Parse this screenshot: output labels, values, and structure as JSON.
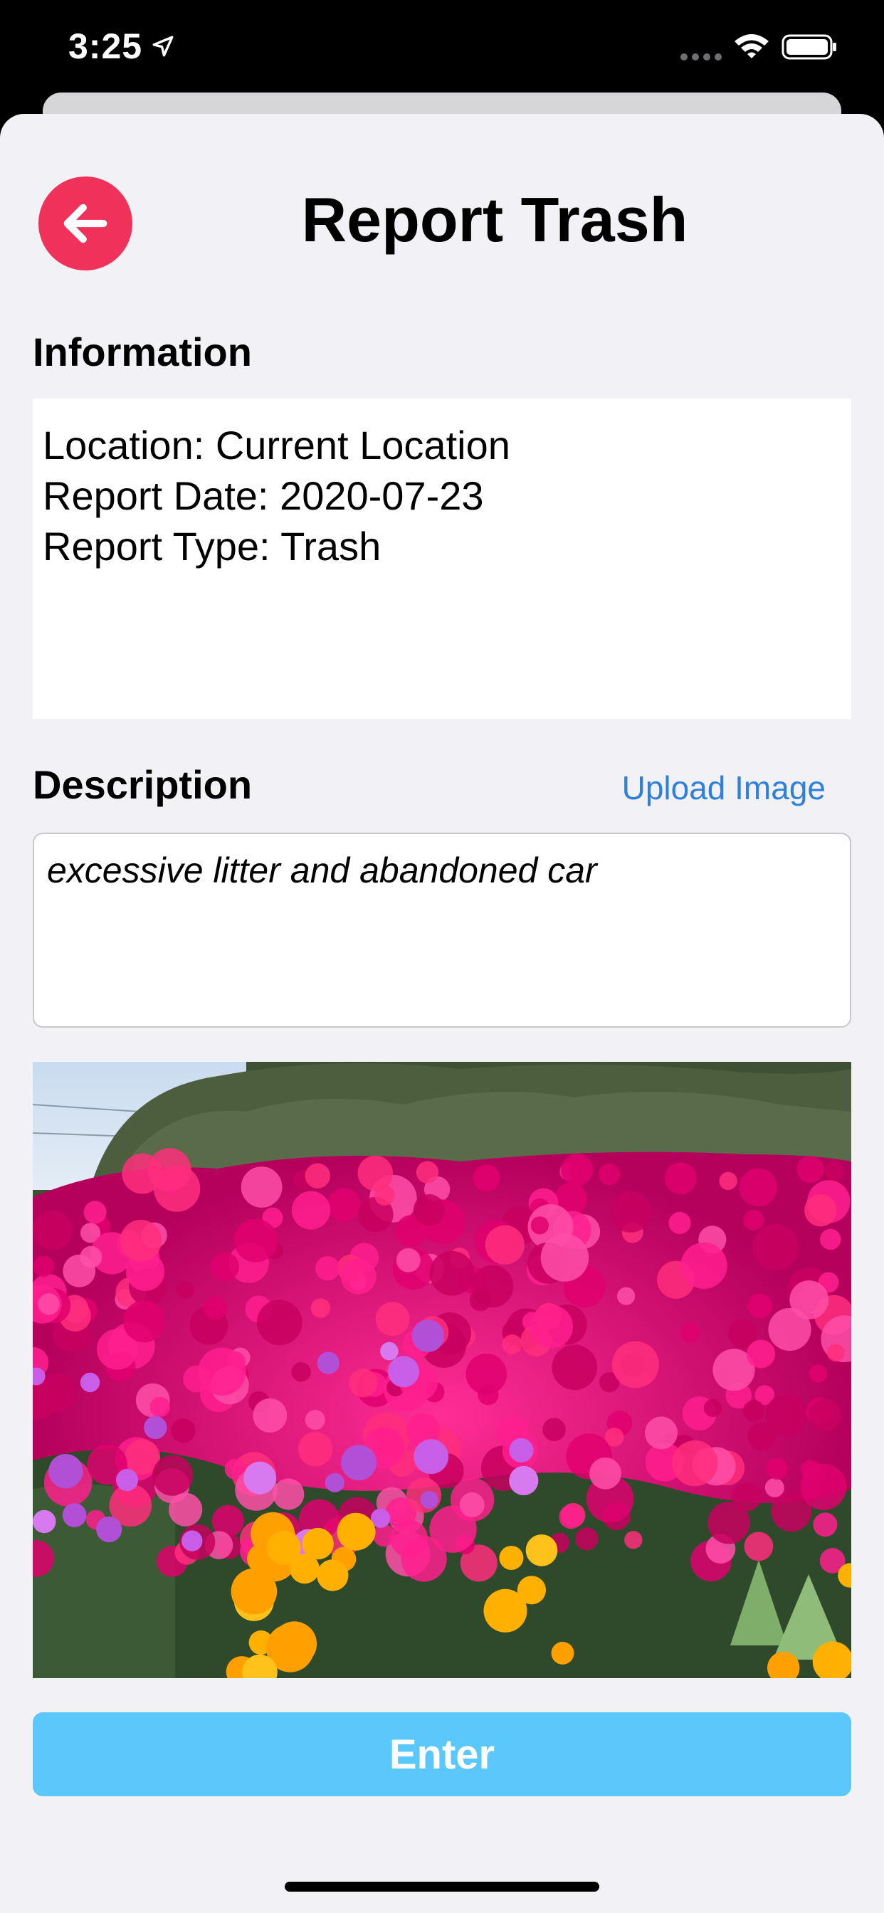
{
  "status_bar": {
    "time": "3:25",
    "icons": [
      "location-arrow-icon",
      "cellular-signal-icon",
      "wifi-icon",
      "battery-icon"
    ]
  },
  "header": {
    "title": "Report Trash",
    "back_icon": "arrow-left-icon",
    "back_button_color": "#f0315a"
  },
  "information": {
    "heading": "Information",
    "lines": [
      "Location: Current Location",
      "Report Date: 2020-07-23",
      "Report Type: Trash"
    ]
  },
  "description": {
    "heading": "Description",
    "upload_label": "Upload Image",
    "value": "excessive litter and abandoned car"
  },
  "photo": {
    "subject": "field of magenta and orange ice plant flowers"
  },
  "submit": {
    "label": "Enter",
    "color": "#5ac8fa"
  },
  "colors": {
    "link": "#2f7fdc",
    "sheet_background": "#f2f2f6"
  }
}
